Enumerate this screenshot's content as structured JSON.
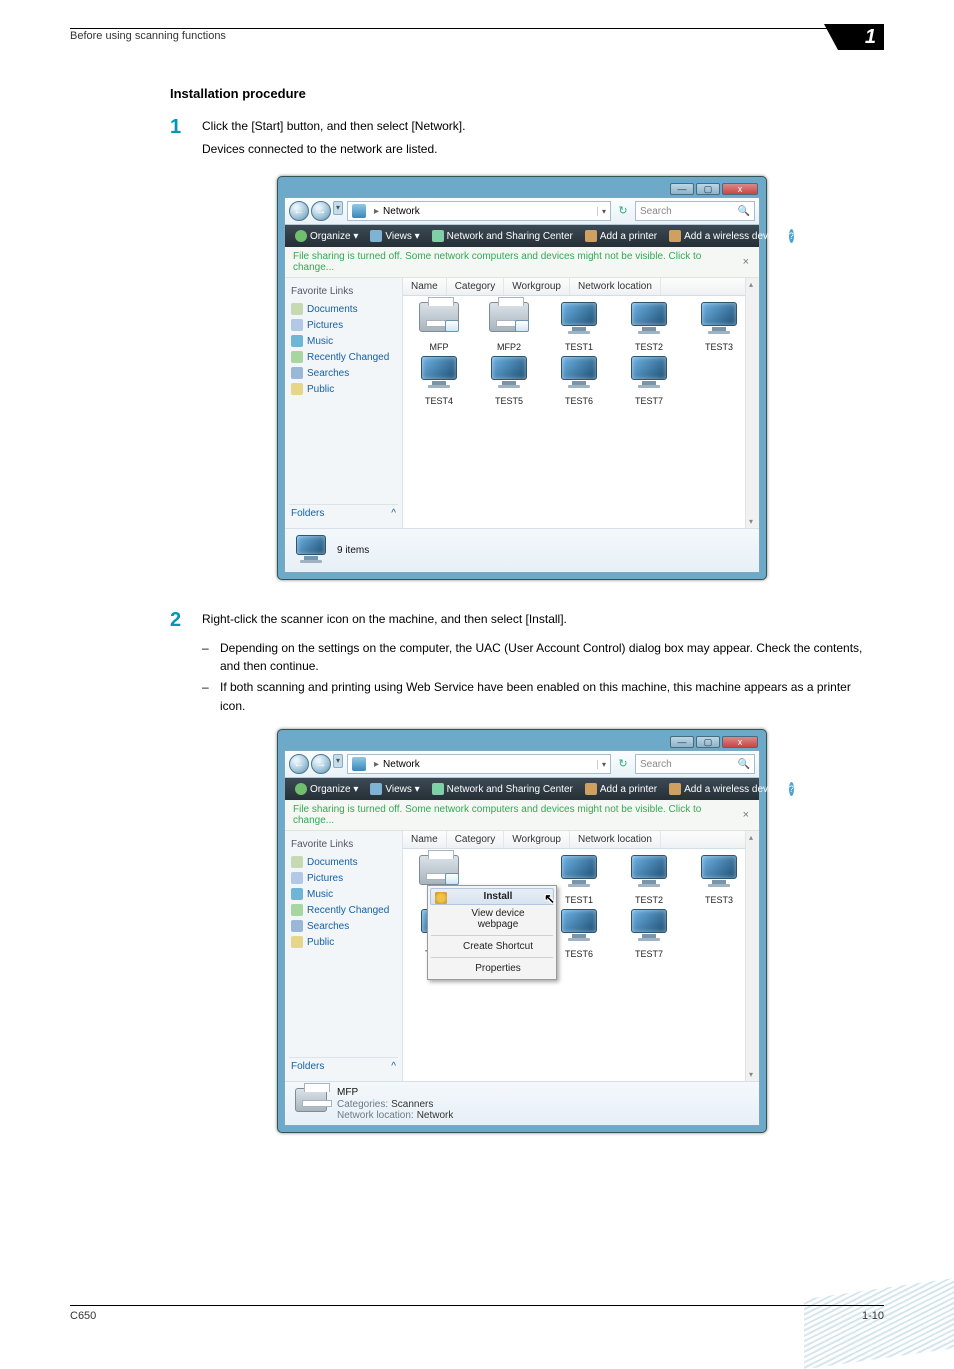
{
  "header": {
    "running": "Before using scanning functions",
    "chapter": "1"
  },
  "section": {
    "title": "Installation procedure"
  },
  "steps": {
    "s1": {
      "num": "1",
      "line1": "Click the [Start] button, and then select [Network].",
      "line2": "Devices connected to the network are listed."
    },
    "s2": {
      "num": "2",
      "line1": "Right-click the scanner icon on the machine, and then select [Install].",
      "b1": "Depending on the settings on the computer, the UAC (User Account Control) dialog box may appear. Check the contents, and then continue.",
      "b2": "If both scanning and printing using Web Service have been enabled on this machine, this machine appears as a printer icon."
    }
  },
  "win": {
    "title_controls": {
      "min": "—",
      "max": "▢",
      "close": "x"
    },
    "nav": {
      "back": "←",
      "fwd": "→",
      "recent": "▾"
    },
    "crumb": {
      "root": "Network",
      "sep": "▸",
      "dd": "▾",
      "refresh": "↻"
    },
    "search": {
      "placeholder": "Search",
      "icon": "🔍"
    },
    "cmdbar": {
      "organize": "Organize ▾",
      "views": "Views  ▾",
      "nscenter": "Network and Sharing Center",
      "addprinter": "Add a printer",
      "addwireless": "Add a wireless device",
      "help": "?"
    },
    "infobar": "File sharing is turned off. Some network computers and devices might not be visible. Click to change...",
    "sidebar": {
      "head": "Favorite Links",
      "items": [
        "Documents",
        "Pictures",
        "Music",
        "Recently Changed",
        "Searches",
        "Public"
      ],
      "folders": "Folders",
      "collapse": "^"
    },
    "cols": [
      "Name",
      "Category",
      "Workgroup",
      "Network location"
    ],
    "devices_row1": [
      "MFP",
      "MFP2",
      "TEST1",
      "TEST2",
      "TEST3"
    ],
    "devices_row2": [
      "TEST4",
      "TEST5",
      "TEST6",
      "TEST7"
    ],
    "details1_title": "9 items",
    "details2_title": "MFP",
    "details2_cat_label": "Categories:",
    "details2_cat_val": "Scanners",
    "details2_loc_label": "Network location:",
    "details2_loc_val": "Network",
    "ctx": {
      "install": "Install",
      "view": "View device webpage",
      "shortcut": "Create Shortcut",
      "props": "Properties"
    }
  },
  "footer": {
    "model": "C650",
    "page": "1-10"
  }
}
